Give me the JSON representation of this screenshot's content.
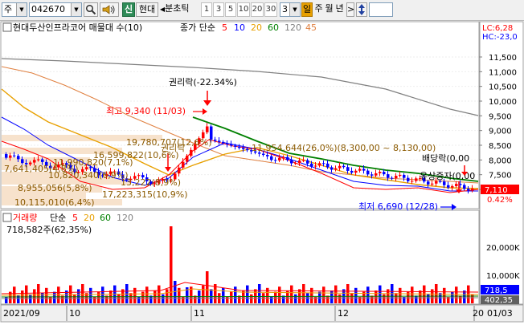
{
  "toolbar": {
    "main_label": "주",
    "code_value": "042670",
    "shin_label": "신",
    "company_label": "현대",
    "tick_label": "분초틱",
    "periods": [
      "1",
      "3",
      "5",
      "10",
      "20",
      "30"
    ],
    "period_select": "3",
    "il_label": "일",
    "ju_label": "주",
    "wol_label": "월",
    "nyeon_label": "년",
    "next_label": ">"
  },
  "chart": {
    "title": "현대두산인프라코어 매물대 수(10)",
    "ma_label": "종가 단순",
    "ma_periods": [
      {
        "label": "5",
        "color": "#ff0000"
      },
      {
        "label": "10",
        "color": "#0000ff"
      },
      {
        "label": "20",
        "color": "#e8a000"
      },
      {
        "label": "60",
        "color": "#008000"
      },
      {
        "label": "120",
        "color": "#808080"
      },
      {
        "label": "45",
        "color": "#e08040"
      }
    ],
    "lc_label": "LC:6,28",
    "hc_label": "HC:-23,0",
    "price_ticks": [
      "11,500",
      "11,000",
      "10,500",
      "10,000",
      "9,500",
      "9,000",
      "8,500",
      "8,000",
      "7,500",
      "7,000"
    ],
    "current_price": "7,110",
    "current_pct": "0.42%",
    "annotations": {
      "rights": "권리락(-22.34%)",
      "high": "최고 9,340 (11/03)",
      "low": "최저 6,690 (12/28)",
      "dividend": "배당락(0,00",
      "capital": "유상증자(0,00"
    },
    "profile_labels": [
      "19,780,707(12,6%)",
      "16,599,822(10,6%)",
      "11,954,644(26,0%)(8,300,00 ~ 8,130,00)",
      "7,641,405(4,8%)",
      "11,990,820(7,1%)",
      "10,820,340(6,9%)",
      "13,222(8,9%)",
      "8,955,056(5,8%)",
      "17,223,315(10,9%)",
      "10,115,010(6,4%)"
    ],
    "pirak_label": "권리락"
  },
  "volume": {
    "title": "거래량",
    "ma_label": "단순",
    "ma_periods": [
      {
        "label": "5",
        "color": "#ff0000"
      },
      {
        "label": "20",
        "color": "#e8a000"
      },
      {
        "label": "60",
        "color": "#008000"
      },
      {
        "label": "120",
        "color": "#808080"
      }
    ],
    "current": "718,582주(62,35%)",
    "ticks": [
      "20,000K",
      "10,000K"
    ],
    "current_box": "718,5",
    "bottom_box": "402,35"
  },
  "xaxis": {
    "labels": [
      "2021/09",
      "10",
      "11",
      "12",
      "20",
      "01/03"
    ]
  },
  "colors": {
    "up": "#ff0000",
    "down": "#0000ff",
    "ma5": "#ff0000",
    "ma10": "#0000ff",
    "ma20": "#e8a000",
    "ma60": "#008000",
    "ma120": "#808080",
    "ma45": "#e08040",
    "profile_bar": "#f7e2cc",
    "label_text": "#8b5a00"
  }
}
